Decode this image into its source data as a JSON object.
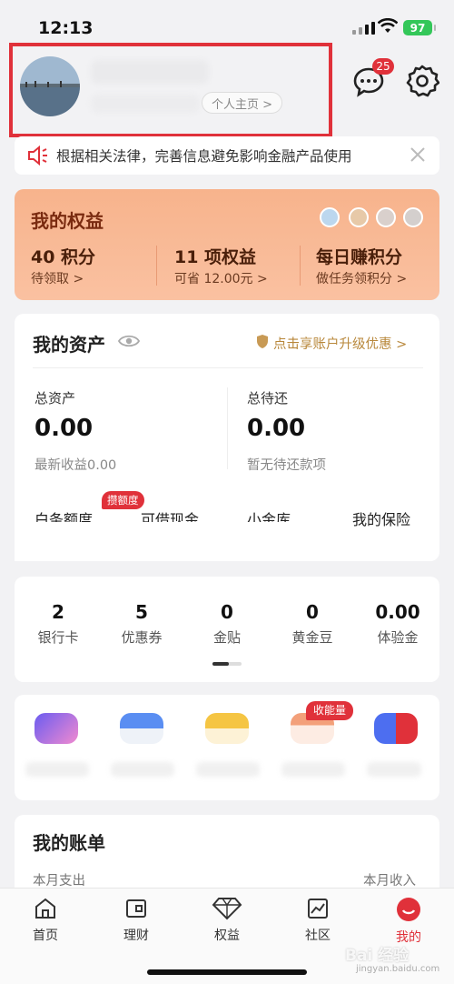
{
  "status_bar": {
    "time": "12:13",
    "battery": "97"
  },
  "profile": {
    "home_link": "个人主页 >",
    "message_count": "25"
  },
  "notice": {
    "text": "根据相关法律，完善信息避免影响金融产品使用"
  },
  "benefits": {
    "title": "我的权益",
    "items": [
      {
        "value": "40 积分",
        "sub": "待领取 >"
      },
      {
        "value": "11 项权益",
        "sub": "可省 12.00元 >"
      },
      {
        "value": "每日赚积分",
        "sub": "做任务领积分 >"
      }
    ]
  },
  "assets": {
    "title": "我的资产",
    "upgrade": "点击享账户升级优惠 >",
    "total": {
      "label": "总资产",
      "value": "0.00",
      "sub": "最新收益0.00"
    },
    "repay": {
      "label": "总待还",
      "value": "0.00",
      "sub": "暂无待还款项"
    },
    "quick": [
      "白条额度",
      "可借现金",
      "小金库",
      "我的保险"
    ],
    "quota_tag": "攒额度"
  },
  "counts": [
    {
      "value": "2",
      "label": "银行卡"
    },
    {
      "value": "5",
      "label": "优惠券"
    },
    {
      "value": "0",
      "label": "金贴"
    },
    {
      "value": "0",
      "label": "黄金豆"
    },
    {
      "value": "0.00",
      "label": "体验金"
    }
  ],
  "services": {
    "energy_tag": "收能量"
  },
  "bill": {
    "title": "我的账单",
    "out_label": "本月支出",
    "in_label": "本月收入"
  },
  "tabs": [
    {
      "label": "首页"
    },
    {
      "label": "理财"
    },
    {
      "label": "权益"
    },
    {
      "label": "社区"
    },
    {
      "label": "我的"
    }
  ],
  "colors": {
    "accent": "#e0313a",
    "benefit_bg": "#f7b38c",
    "gold": "#b8873a"
  },
  "watermark": {
    "text": "Bai 经验",
    "sub": "jingyan.baidu.com"
  }
}
